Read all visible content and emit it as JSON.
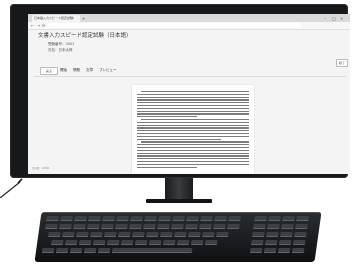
{
  "browser": {
    "tab_title": "日本語入力スピード認定試験",
    "tab_close": "×",
    "new_tab": "+",
    "minimize": "–",
    "maximize": "□",
    "close": "×",
    "back": "←",
    "forward": "→",
    "reload": "⟳"
  },
  "page": {
    "title": "文書入力スピード認定試験（日本語）",
    "meta": [
      {
        "label": "受験番号：",
        "value": "0001"
      },
      {
        "label": "氏名：",
        "value": "日本太郎"
      }
    ],
    "side_button": "終了",
    "back_button": "戻る",
    "toolbar": [
      "開始",
      "問題",
      "文章",
      "プレビュー"
    ],
    "status": "文字数　0/300"
  },
  "document": {
    "line_count": 28,
    "paragraph_breaks": [
      0,
      10,
      18
    ]
  },
  "colors": {
    "bezel": "#16181a",
    "screen_bg": "#f4f4f4",
    "keyboard": "#1c1e21"
  },
  "icons": {
    "cable": "cable-icon"
  }
}
